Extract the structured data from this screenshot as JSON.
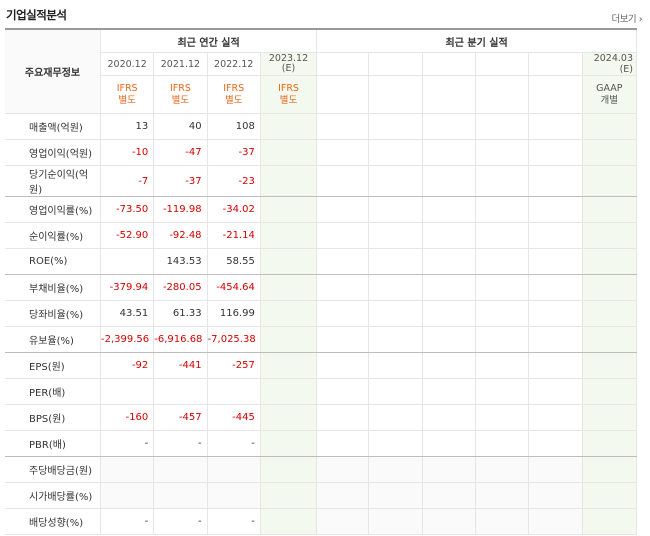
{
  "header": {
    "title": "기업실적분석",
    "more_link": "더보기 ›"
  },
  "table": {
    "row_header_label": "주요재무정보",
    "annual_group_label": "최근 연간 실적",
    "quarter_group_label": "최근 분기 실적",
    "annual_periods": [
      "2020.12",
      "2021.12",
      "2022.12",
      "2023.12\n(E)"
    ],
    "quarter_last_period": "2024.03 (E)",
    "annual_standards": [
      "IFRS\n별도",
      "IFRS\n별도",
      "IFRS\n별도",
      "IFRS\n별도"
    ],
    "quarter_last_standard": "GAAP\n개별",
    "rows": [
      {
        "label": "매출액(억원)",
        "values": [
          "13",
          "40",
          "108"
        ]
      },
      {
        "label": "영업이익(억원)",
        "values": [
          "-10",
          "-47",
          "-37"
        ]
      },
      {
        "label": "당기순이익(억원)",
        "values": [
          "-7",
          "-37",
          "-23"
        ]
      },
      {
        "label": "영업이익률(%)",
        "values": [
          "-73.50",
          "-119.98",
          "-34.02"
        ]
      },
      {
        "label": "순이익률(%)",
        "values": [
          "-52.90",
          "-92.48",
          "-21.14"
        ]
      },
      {
        "label": "ROE(%)",
        "values": [
          "",
          "143.53",
          "58.55"
        ]
      },
      {
        "label": "부채비율(%)",
        "values": [
          "-379.94",
          "-280.05",
          "-454.64"
        ]
      },
      {
        "label": "당좌비율(%)",
        "values": [
          "43.51",
          "61.33",
          "116.99"
        ]
      },
      {
        "label": "유보율(%)",
        "values": [
          "-2,399.56",
          "-6,916.68",
          "-7,025.38"
        ]
      },
      {
        "label": "EPS(원)",
        "values": [
          "-92",
          "-441",
          "-257"
        ]
      },
      {
        "label": "PER(배)",
        "values": [
          "",
          "",
          ""
        ]
      },
      {
        "label": "BPS(원)",
        "values": [
          "-160",
          "-457",
          "-445"
        ]
      },
      {
        "label": "PBR(배)",
        "values": [
          "-",
          "-",
          "-"
        ]
      },
      {
        "label": "주당배당금(원)",
        "values": [
          "",
          "",
          ""
        ]
      },
      {
        "label": "시가배당률(%)",
        "values": [
          "",
          "",
          ""
        ]
      },
      {
        "label": "배당성향(%)",
        "values": [
          "-",
          "-",
          "-"
        ]
      }
    ],
    "group_breaks_after": [
      2,
      5,
      8,
      12
    ]
  },
  "colors": {
    "negative": "#d40000",
    "ifrs": "#e8671c",
    "estimate_bg": "#f3f9ee",
    "header_border": "#999999"
  }
}
